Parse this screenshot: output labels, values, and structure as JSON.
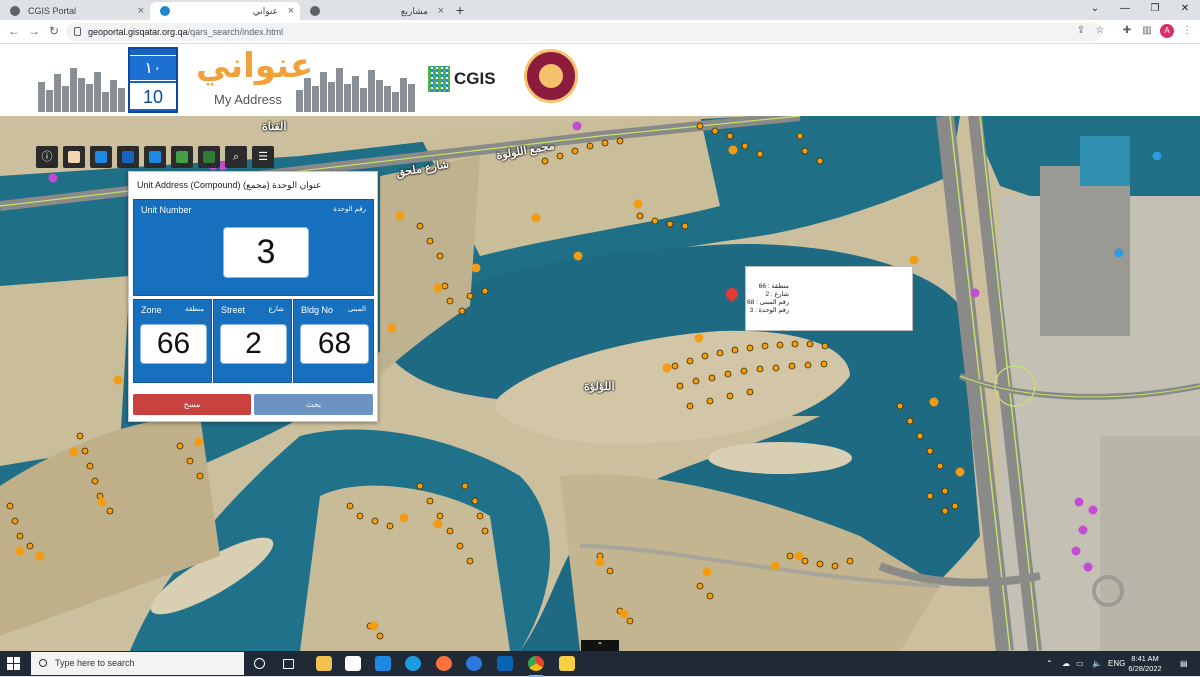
{
  "browser": {
    "tabs": [
      {
        "title": "CGIS Portal",
        "active": false
      },
      {
        "title": "عنواني",
        "active": true
      },
      {
        "title": "مشاريع",
        "active": false
      }
    ],
    "new_tab": "+",
    "url_host": "geoportal.gisqatar.org.qa",
    "url_path": "/qars_search/index.html",
    "avatar_letter": "A"
  },
  "header": {
    "plate_top": "١٠",
    "plate_bottom": "10",
    "brand_ar": "عنواني",
    "brand_en": "My Address",
    "cgis": "CGIS"
  },
  "map": {
    "labels": [
      {
        "text": "اللؤلؤة"
      },
      {
        "text": "القناة"
      },
      {
        "text": "شارع ملحق"
      },
      {
        "text": "مجمع اللولوة"
      }
    ]
  },
  "panel": {
    "title": "Unit Address (Compound) (مجمع) عنوان الوحدة",
    "unit_label_en": "Unit Number",
    "unit_label_ar": "رقم الوحدة",
    "unit_value": "3",
    "zone_label_en": "Zone",
    "zone_label_ar": "منطقة",
    "zone_value": "66",
    "street_label_en": "Street",
    "street_label_ar": "شارع",
    "street_value": "2",
    "bldg_label_en": "Bldg No",
    "bldg_label_ar": "المبنى",
    "bldg_value": "68",
    "clear_label": "مسح",
    "search_label": "بحث"
  },
  "popup": {
    "lines": [
      "منطقة : 66",
      "شارع : 2",
      "رقم المبنى : 68",
      "رقم الوحدة : 3"
    ]
  },
  "taskbar": {
    "search_placeholder": "Type here to search",
    "lang": "ENG",
    "time": "8:41 AM",
    "date": "6/28/2022"
  },
  "colors": {
    "water": "#1e6f87",
    "land": "#cbbf9e",
    "panel_blue": "#1670be",
    "clear_red": "#c9423f",
    "search_blue": "#6c93c2",
    "marker_orange": "#f39c12"
  }
}
